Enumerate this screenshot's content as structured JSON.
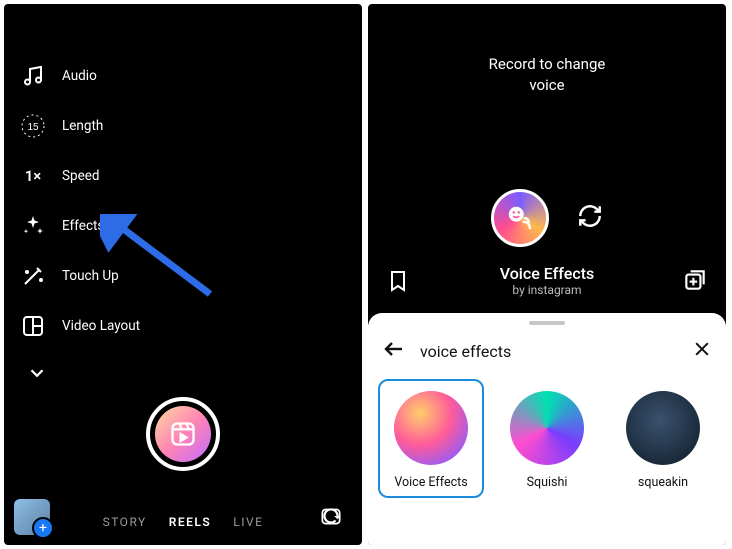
{
  "left": {
    "tools": [
      {
        "label": "Audio"
      },
      {
        "label": "Length",
        "value": "15"
      },
      {
        "label": "Speed",
        "value": "1×"
      },
      {
        "label": "Effects"
      },
      {
        "label": "Touch Up"
      },
      {
        "label": "Video Layout"
      }
    ],
    "modes": {
      "story": "STORY",
      "reels": "REELS",
      "live": "LIVE"
    }
  },
  "right": {
    "hint_line1": "Record to change",
    "hint_line2": "voice",
    "effect_title": "Voice Effects",
    "effect_author": "by instagram",
    "search_query": "voice effects",
    "results": [
      {
        "label": "Voice Effects"
      },
      {
        "label": "Squishi"
      },
      {
        "label": "squeakin"
      }
    ]
  }
}
